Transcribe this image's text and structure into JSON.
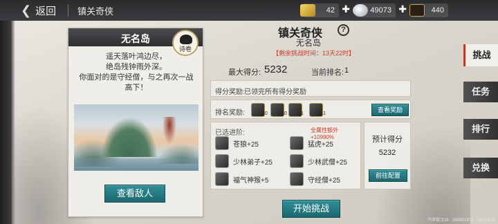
{
  "topbar": {
    "back_label": "返回",
    "title": "镇关奇侠",
    "resources": [
      {
        "icon": "gold-ingot-icon",
        "value": "42"
      },
      {
        "icon": "silver-ingot-icon",
        "value": "49073"
      },
      {
        "icon": "token-icon",
        "value": "440"
      }
    ]
  },
  "card": {
    "title": "无名岛",
    "stamp_label": "诗卷",
    "poem": [
      "遥天落叶鸿边尽，",
      "绝岛残钟雨外深。",
      "你面对的是守经僧，与之再次一战",
      "高下！"
    ],
    "view_enemy": "查看敌人"
  },
  "main": {
    "title": "镇关奇侠",
    "subtitle": "无名岛",
    "time_left": "【剩余挑战时间：13天22时】",
    "max_score_label": "最大得分:",
    "max_score": "5232",
    "rank_label": "当前排名:",
    "rank": "1",
    "score_reward_label": "得分奖励:",
    "score_reward_value": "已领完所有得分奖励",
    "rank_reward_label": "排名奖励:",
    "rank_reward_counts": [
      "10",
      "10",
      "1",
      "1"
    ],
    "view_reward": "查看奖励",
    "selected_label": "已选进阶:",
    "bonus": "全属性额外+10990%",
    "skills": [
      {
        "name": "苍狼+25"
      },
      {
        "name": "猛虎+25"
      },
      {
        "name": "少林弟子+25"
      },
      {
        "name": "少林武僧+25"
      },
      {
        "name": "福气神猴+5"
      },
      {
        "name": "守经僧+25"
      }
    ],
    "predict_label": "预计得分",
    "predict_value": "5232",
    "goto_config": "前往配置",
    "start": "开始挑战"
  },
  "tabs": [
    "挑战",
    "任务",
    "排行",
    "兑换"
  ],
  "footer": "汽冲霄汉38 · 288581373 · 08250133"
}
